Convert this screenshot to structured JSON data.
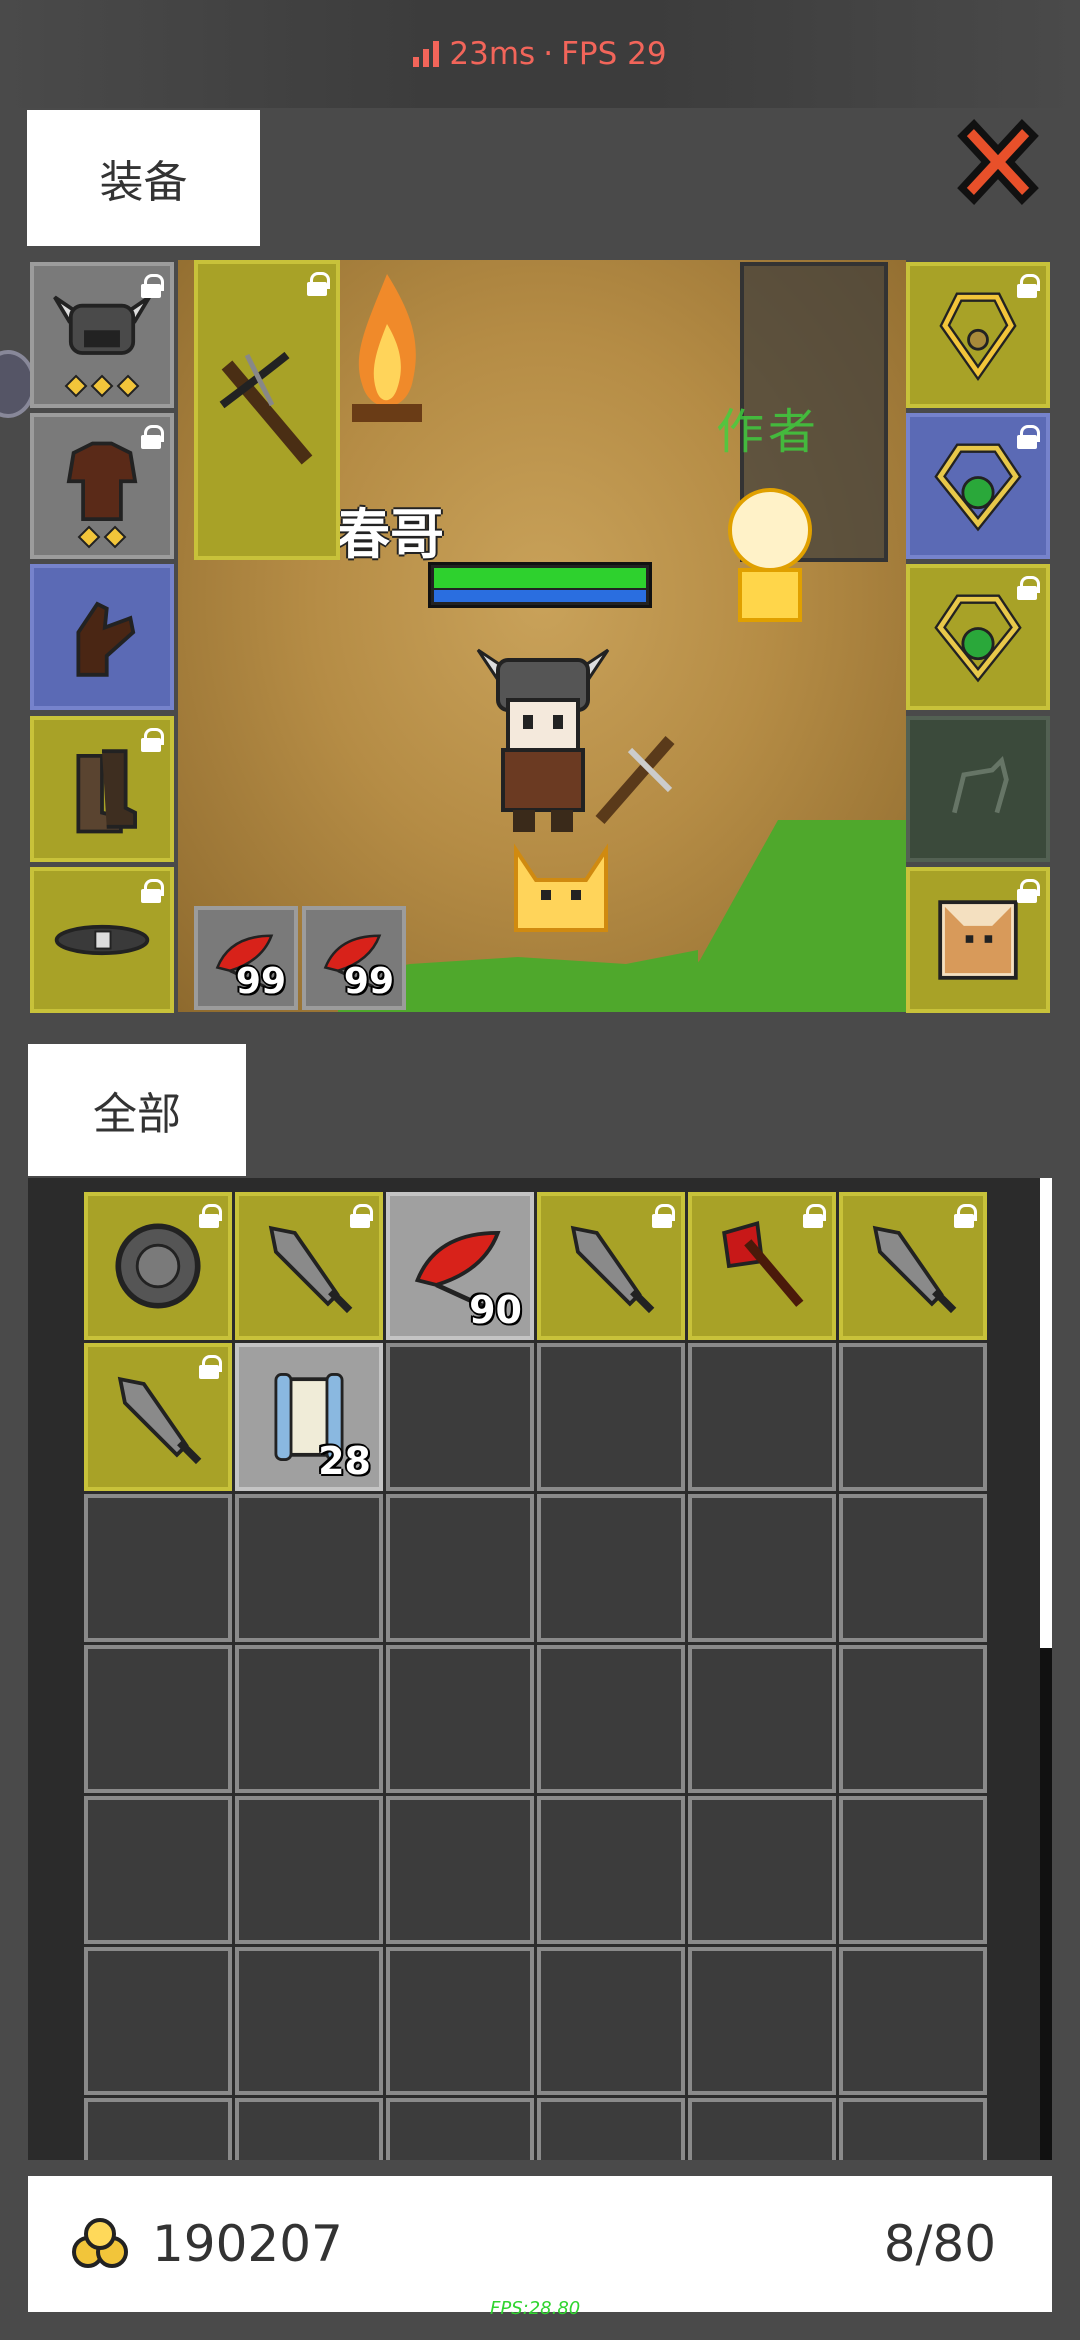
{
  "status": {
    "latency": "23ms",
    "separator": "·",
    "fps": "FPS 29"
  },
  "tabs": {
    "equipment": "装备",
    "all": "全部"
  },
  "character": {
    "name": "春哥",
    "tag": "作者"
  },
  "equipment": {
    "left": [
      {
        "icon": "horned-helmet-icon",
        "rarity": "gray",
        "locked": true,
        "stars": 3
      },
      {
        "icon": "leather-armor-icon",
        "rarity": "gray",
        "locked": true,
        "stars": 2
      },
      {
        "icon": "glove-icon",
        "rarity": "blue",
        "locked": false
      },
      {
        "icon": "boots-icon",
        "rarity": "yellow",
        "locked": true
      },
      {
        "icon": "belt-icon",
        "rarity": "yellow",
        "locked": true
      }
    ],
    "weapon": {
      "icon": "crossbow-icon",
      "rarity": "yellow",
      "locked": true
    },
    "right": [
      {
        "icon": "gold-amulet-icon",
        "rarity": "yellow",
        "locked": true
      },
      {
        "icon": "green-ring-icon",
        "rarity": "blue",
        "locked": true
      },
      {
        "icon": "green-ring-icon",
        "rarity": "yellow",
        "locked": true
      },
      {
        "icon": "mount-slot-icon",
        "rarity": "empty",
        "locked": false
      },
      {
        "icon": "pet-cat-icon",
        "rarity": "yellow",
        "locked": true
      }
    ],
    "quick": [
      {
        "icon": "red-feather-icon",
        "count": "99"
      },
      {
        "icon": "red-feather-icon",
        "count": "99"
      }
    ]
  },
  "inventory": {
    "columns": 6,
    "items": [
      {
        "icon": "round-shield-icon",
        "rarity": "yellow",
        "locked": true,
        "count": ""
      },
      {
        "icon": "spear-head-icon",
        "rarity": "yellow",
        "locked": true,
        "count": ""
      },
      {
        "icon": "red-feather-icon",
        "rarity": "gray",
        "locked": false,
        "count": "90"
      },
      {
        "icon": "spear-head-icon",
        "rarity": "yellow",
        "locked": true,
        "count": ""
      },
      {
        "icon": "red-axe-icon",
        "rarity": "yellow",
        "locked": true,
        "count": ""
      },
      {
        "icon": "spear-head-icon",
        "rarity": "yellow",
        "locked": true,
        "count": ""
      },
      {
        "icon": "spear-head-icon",
        "rarity": "yellow",
        "locked": true,
        "count": ""
      },
      {
        "icon": "scroll-icon",
        "rarity": "gray",
        "locked": false,
        "count": "28"
      }
    ]
  },
  "footer": {
    "gold": "190207",
    "capacity": "8/80",
    "fps_debug": "FPS:28.80"
  },
  "colors": {
    "rare_yellow": "#a8a227",
    "rare_blue": "#5b6ab5",
    "common_gray": "#a0a0a0",
    "alert_red": "#f2655a"
  }
}
